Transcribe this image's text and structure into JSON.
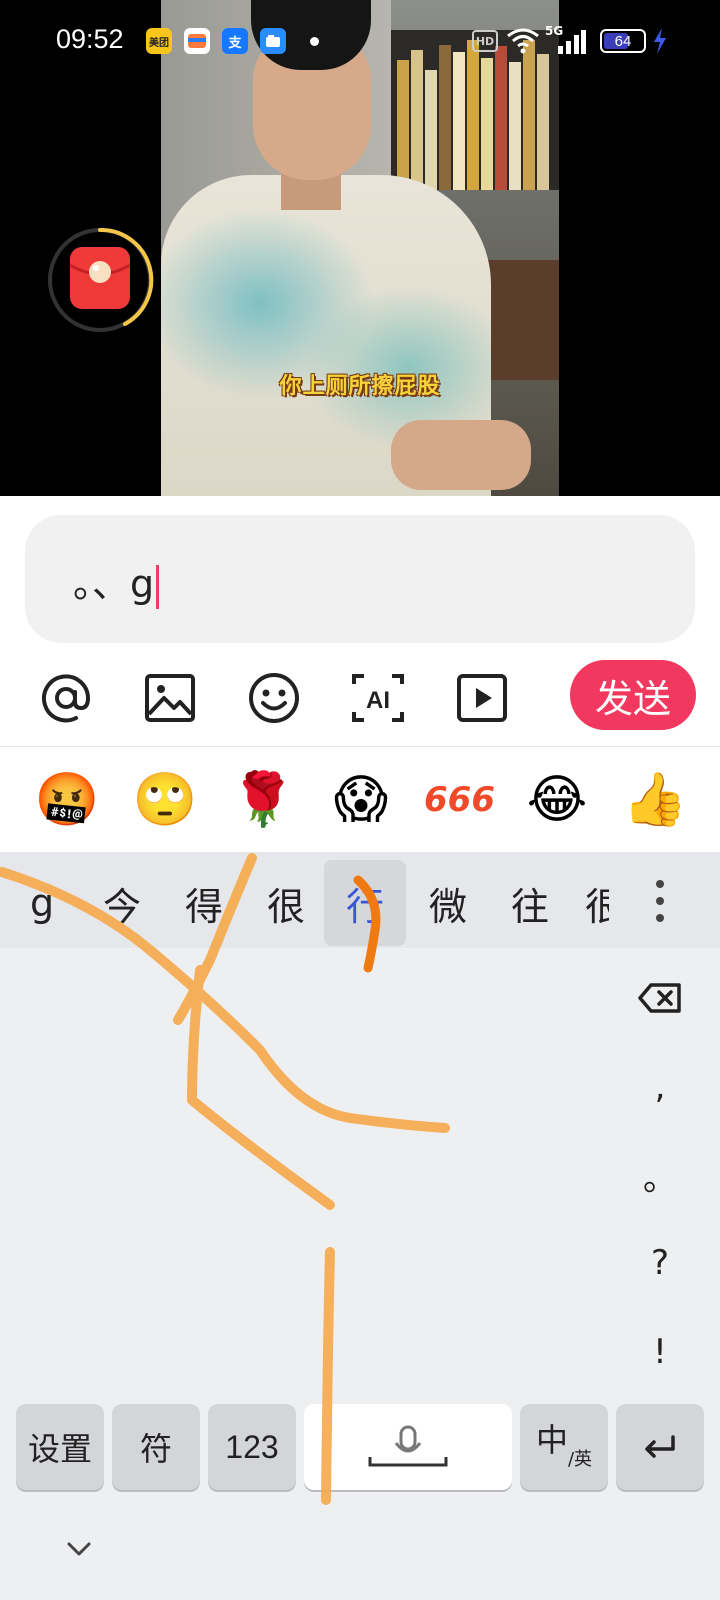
{
  "status_bar": {
    "time": "09:52",
    "app_icons": [
      {
        "name": "meituan-icon",
        "label": "美团",
        "color": "#f7c51b"
      },
      {
        "name": "wallet-icon",
        "label": "",
        "color": "#ff7a3c"
      },
      {
        "name": "alipay-icon",
        "label": "支",
        "color": "#1677ff"
      },
      {
        "name": "files-icon",
        "label": "",
        "color": "#2b8cff"
      }
    ],
    "hd_label": "HD",
    "network_label": "5G",
    "battery_level": "64",
    "battery_fraction": 0.64
  },
  "video": {
    "subtitle": "你上厕所擦屁股"
  },
  "comment": {
    "input_value": "。、g",
    "send_label": "发送",
    "accent_color": "#f2385e"
  },
  "toolbar": {
    "tools": [
      "mention-icon",
      "image-icon",
      "emoji-icon",
      "ai-icon",
      "video-icon"
    ],
    "ai_label": "AI"
  },
  "emoji_bar": [
    {
      "name": "angry-cursing-emoji",
      "glyph": "🤬"
    },
    {
      "name": "eye-roll-emoji",
      "glyph": "🙄"
    },
    {
      "name": "rose-emoji",
      "glyph": "🌹"
    },
    {
      "name": "shocked-emoji",
      "glyph": "😱"
    },
    {
      "name": "666-emoji",
      "glyph": "666"
    },
    {
      "name": "laugh-cry-emoji",
      "glyph": "😂"
    },
    {
      "name": "thumbs-up-emoji",
      "glyph": "👍"
    }
  ],
  "keyboard": {
    "candidates": [
      "g",
      "今",
      "得",
      "很",
      "行",
      "微",
      "往",
      "很"
    ],
    "selected_candidate_index": 4,
    "side_keys": [
      ",",
      "。",
      "?",
      "!"
    ],
    "bottom_keys": {
      "settings": "设置",
      "symbols": "符",
      "numbers": "123",
      "lang_main": "中",
      "lang_sub": "/英"
    }
  }
}
